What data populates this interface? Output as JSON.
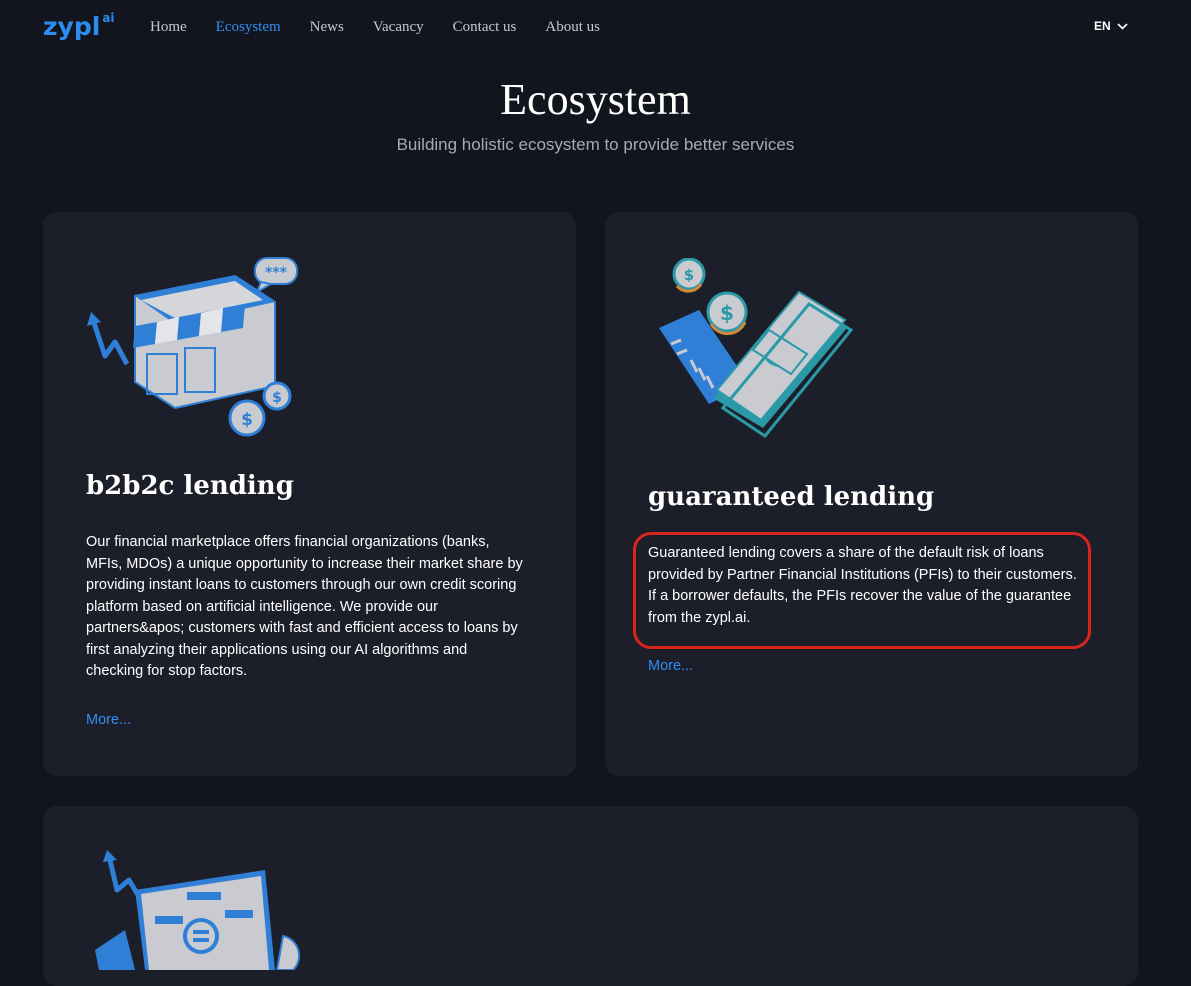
{
  "header": {
    "logo_text": "zypl",
    "logo_sup": "ai",
    "nav": [
      "Home",
      "Ecosystem",
      "News",
      "Vacancy",
      "Contact us",
      "About us"
    ],
    "active_nav": "Ecosystem",
    "lang": "EN"
  },
  "hero": {
    "title": "Ecosystem",
    "subtitle": "Building holistic ecosystem to provide better services"
  },
  "cards": [
    {
      "title": "b2b2c lending",
      "text": "Our financial marketplace offers financial organizations (banks, MFIs, MDOs) a unique opportunity to increase their market share by providing instant loans to customers through our own credit scoring platform based on artificial intelligence. We provide our partners&apos; customers with fast and efficient access to loans by first analyzing their applications using our AI algorithms and checking for stop factors.",
      "more": "More...",
      "icon": "storefront-icon"
    },
    {
      "title": "guaranteed lending",
      "text": "Guaranteed lending covers a share of the default risk of loans provided by Partner Financial Institutions (PFIs) to their customers. If a borrower defaults, the PFIs recover the value of the guarantee from the zypl.ai.",
      "more": "More...",
      "icon": "money-card-icon"
    },
    {
      "icon": "tablet-chart-icon"
    }
  ],
  "colors": {
    "accent": "#2f8ef4",
    "background": "#12151d",
    "card": "#1c1f29",
    "highlight": "#d7261e"
  }
}
